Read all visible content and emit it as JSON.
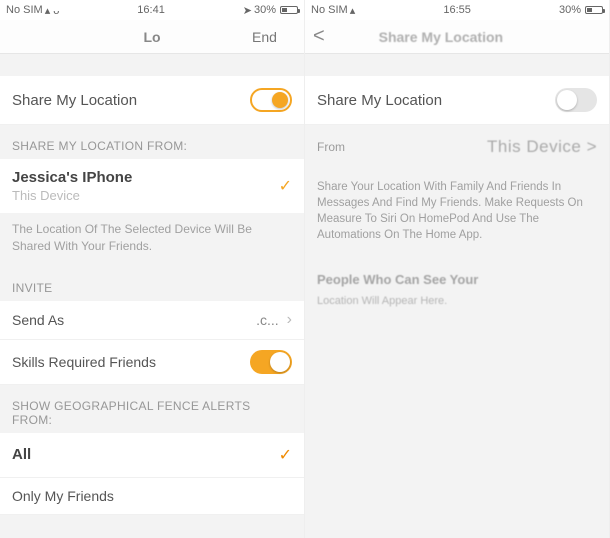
{
  "left": {
    "status": {
      "carrier": "No SIM",
      "time": "16:41",
      "battery_text": "30%",
      "battery_fill": "30%"
    },
    "nav": {
      "back": "",
      "title": "Lo",
      "right": "End"
    },
    "share_toggle_label": "Share My Location",
    "share_toggle_on": true,
    "from_header": "SHARE MY LOCATION FROM:",
    "device": {
      "name": "Jessica's IPhone",
      "sub": "This Device",
      "selected": true
    },
    "from_desc": "The Location Of The Selected Device Will Be Shared With Your Friends.",
    "invite_header": "INVITE",
    "send_as": {
      "label": "Send As",
      "value": ".c..."
    },
    "skills_row": {
      "label": "Skills Required Friends",
      "on": true
    },
    "alerts_header": "SHOW GEOGRAPHICAL FENCE ALERTS FROM:",
    "alerts": {
      "all": "All",
      "only": "Only My Friends",
      "selected_index": 0
    }
  },
  "right": {
    "status": {
      "carrier": "No SIM",
      "time": "16:55",
      "battery_text": "30%",
      "battery_fill": "30%"
    },
    "nav": {
      "back": "<",
      "title": "Share My Location",
      "right": ""
    },
    "share_toggle_label": "Share My Location",
    "share_toggle_on": false,
    "from": {
      "label": "From",
      "value": "This Device >"
    },
    "desc1": "Share Your Location With Family And Friends In Messages And Find My Friends. Make Requests On Measure To Siri On HomePod And Use The Automations On The Home App.",
    "people_title": "People Who Can See Your",
    "people_sub": "Location Will Appear Here."
  }
}
